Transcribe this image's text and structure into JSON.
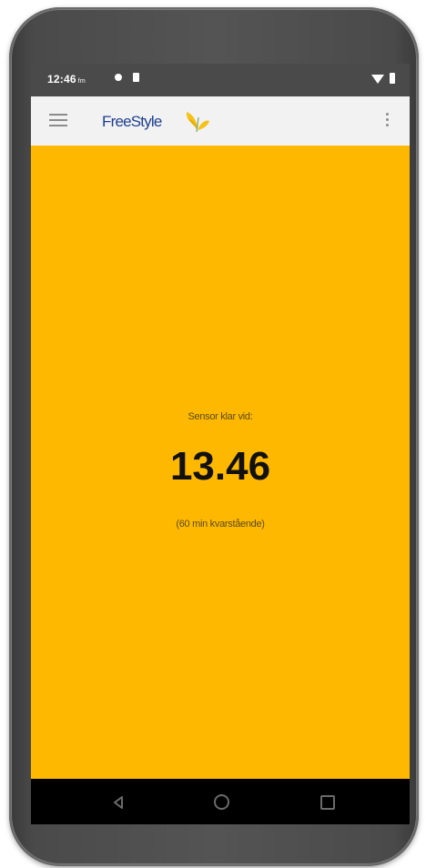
{
  "status_bar": {
    "time": "12:46",
    "time_suffix": "fm",
    "icons": [
      "notification-dot-icon",
      "sim-icon",
      "wifi-icon",
      "battery-icon"
    ]
  },
  "app_bar": {
    "brand": "FreeStyle",
    "icons": [
      "menu-icon",
      "butterfly-logo-icon",
      "more-vert-icon"
    ]
  },
  "sensor": {
    "label": "Sensor klar vid:",
    "time": "13.46",
    "remaining": "(60 min kvarstående)"
  },
  "nav_bar": {
    "icons": [
      "back-icon",
      "home-icon",
      "recents-icon"
    ]
  },
  "colors": {
    "background": "#ffb800",
    "app_bar": "#f2f2f2",
    "brand": "#1d3f8f",
    "status_bar": "#4a4a4a",
    "nav_bar": "#000000"
  }
}
